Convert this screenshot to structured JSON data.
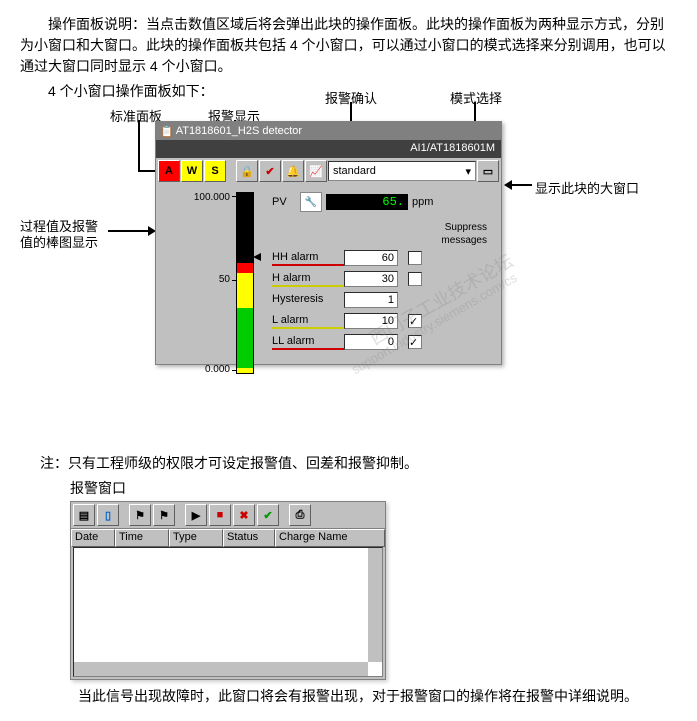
{
  "text": {
    "p1": "操作面板说明：当点击数值区域后将会弹出此块的操作面板。此块的操作面板为两种显示方式，分别为小窗口和大窗口。此块的操作面板共包括 4 个小窗口，可以通过小窗口的模式选择来分别调用，也可以通过大窗口同时显示 4 个小窗口。",
    "p2": "4 个小窗口操作面板如下：",
    "note": "注：只有工程师级的权限才可设定报警值、回差和报警抑制。",
    "alarm_title": "报警窗口",
    "p3": "当此信号出现故障时，此窗口将会有报警出现，对于报警窗口的操作将在报警中详细说明。"
  },
  "annotations": {
    "std_panel": "标准面板",
    "alarm_display": "报警显示",
    "alarm_ack": "报警确认",
    "mode_select": "模式选择",
    "show_big": "显示此块的大窗口",
    "bar_chart": "过程值及报警",
    "bar_chart2": "值的棒图显示"
  },
  "panel": {
    "title": "AT1818601_H2S detector",
    "tag": "AI1/AT1818601M",
    "btn_a": "A",
    "btn_w": "W",
    "btn_s": "S",
    "mode": "standard",
    "scale_top": "100.000",
    "scale_mid": "50",
    "scale_bot": "0.000",
    "pv_label": "PV",
    "pv_value": "65.",
    "pv_unit": "ppm",
    "suppress": "Suppress",
    "messages": "messages",
    "rows": {
      "hh": {
        "label": "HH alarm",
        "val": "60"
      },
      "h": {
        "label": "H alarm",
        "val": "30"
      },
      "hy": {
        "label": "Hysteresis",
        "val": "1"
      },
      "l": {
        "label": "L alarm",
        "val": "10"
      },
      "ll": {
        "label": "LL alarm",
        "val": "0"
      }
    }
  },
  "alarm_win": {
    "h_date": "Date",
    "h_time": "Time",
    "h_type": "Type",
    "h_status": "Status",
    "h_charge": "Charge Name"
  },
  "watermark": {
    "l1": "西门子工业技术论坛",
    "l2": "support.industry.siemens.com/cs"
  }
}
